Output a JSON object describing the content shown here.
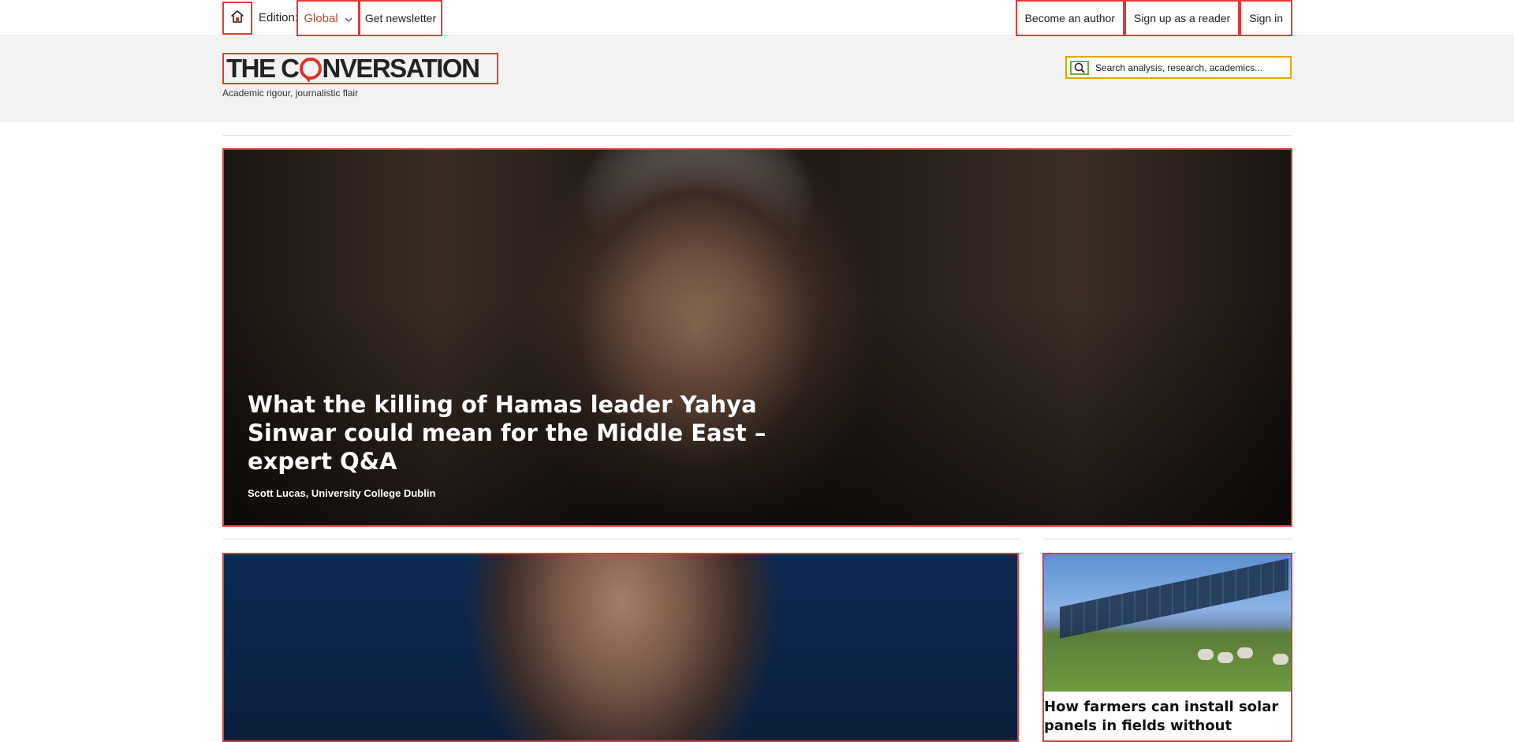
{
  "topbar": {
    "edition_label": "Edition:",
    "edition_value": "Global",
    "newsletter_label": "Get newsletter",
    "right_links": [
      "Become an author",
      "Sign up as a reader",
      "Sign in"
    ]
  },
  "header": {
    "logo_text_before": "THE C",
    "logo_text_after": "NVERSATION",
    "tagline": "Academic rigour, journalistic flair",
    "search_placeholder": "Search analysis, research, academics..."
  },
  "hero": {
    "title": "What the killing of Hamas leader Yahya Sinwar could mean for the Middle East – expert Q&A",
    "author": "Scott Lucas, University College Dublin"
  },
  "stories": {
    "side_title": "How farmers can install solar panels in fields without"
  },
  "icons": {
    "home": "home-icon",
    "chevron": "chevron-down-icon",
    "search": "search-icon"
  },
  "colors": {
    "brand_red": "#d8352a",
    "edition_text": "#c0492e",
    "header_bg": "#f2f2f2"
  }
}
